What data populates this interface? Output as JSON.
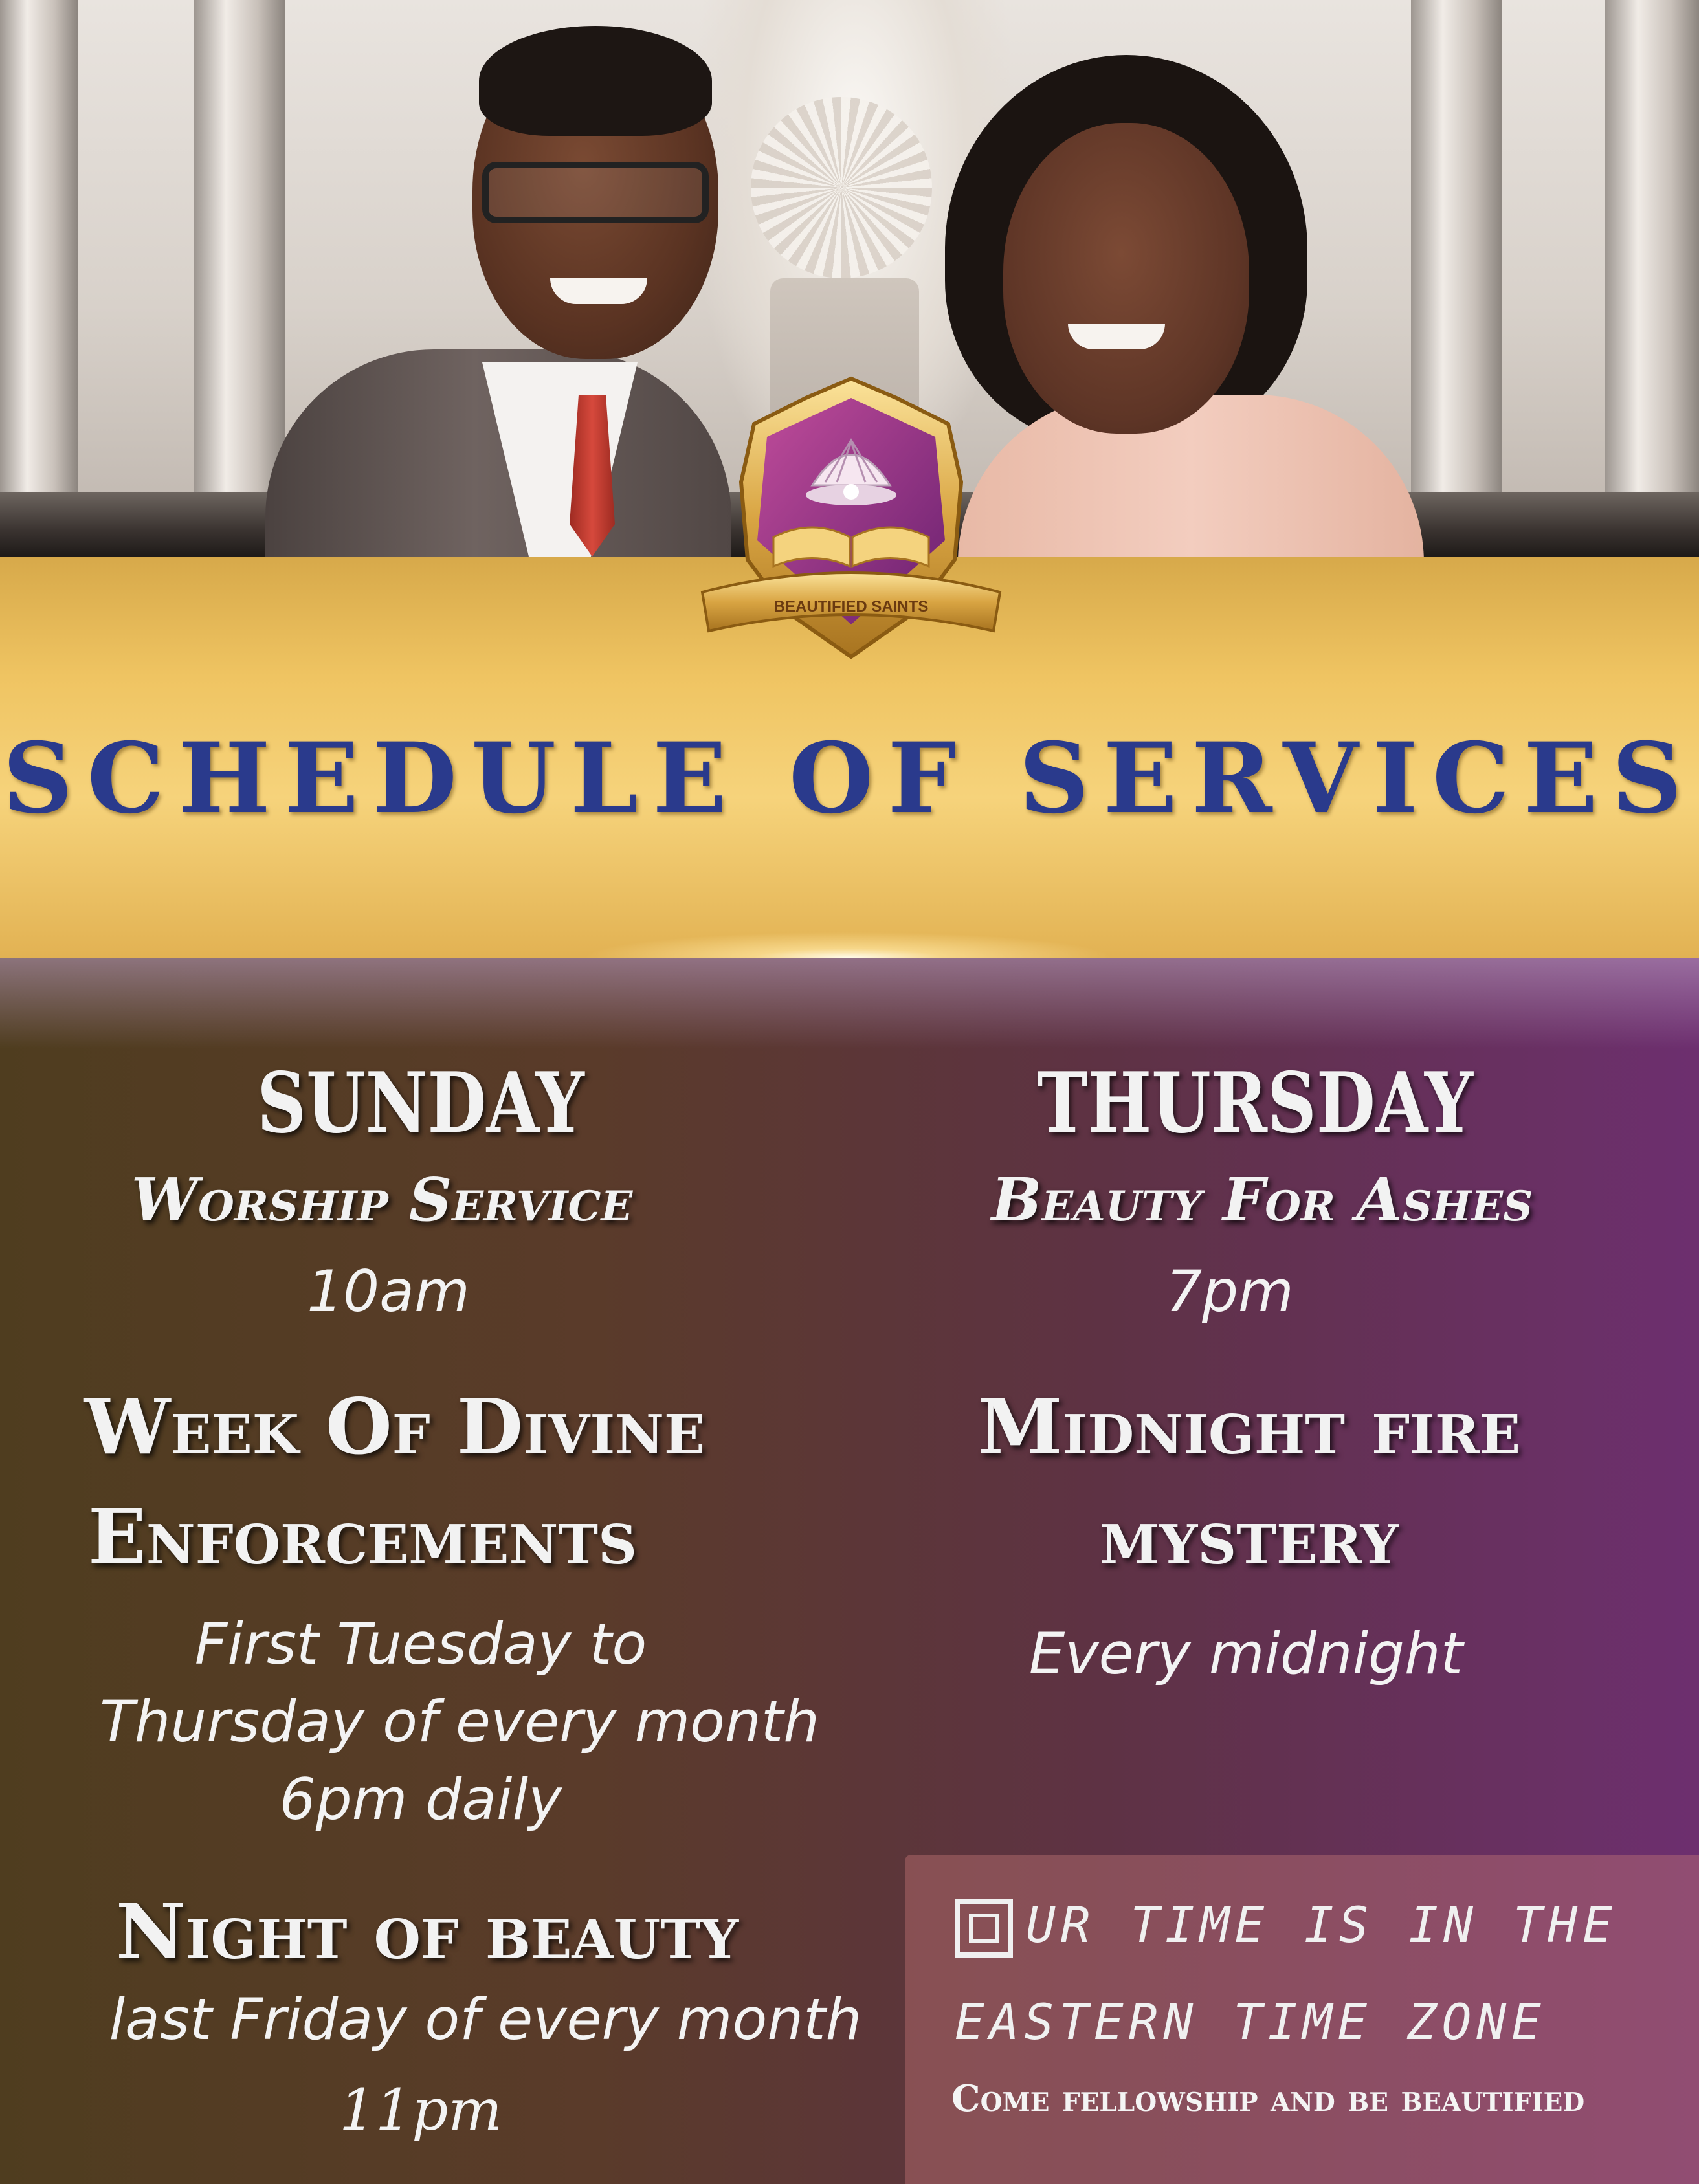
{
  "logo": {
    "banner_text": "BEAUTIFIED SAINTS"
  },
  "title": "SCHEDULE OF SERVICES",
  "left_column": {
    "sunday": {
      "day": "SUNDAY",
      "service": "Worship Service",
      "time": "10am"
    },
    "enforcements": {
      "title_line1": "Week Of Divine",
      "title_line2": "Enforcements",
      "detail_line1": "First Tuesday to",
      "detail_line2": "Thursday of every month",
      "detail_line3": "6pm daily"
    },
    "night": {
      "title": "Night of beauty",
      "detail": "last Friday of every month",
      "time": "11pm"
    }
  },
  "right_column": {
    "thursday": {
      "day": "THURSDAY",
      "service": "Beauty For Ashes",
      "time": "7pm"
    },
    "midnight": {
      "title_line1": "Midnight fire",
      "title_line2": "mystery",
      "detail": "Every midnight"
    }
  },
  "timezone_box": {
    "line1": "UR TIME IS IN THE",
    "line2": "EASTERN TIME ZONE",
    "footer": "Come fellowship and be beautified"
  },
  "colors": {
    "gold": "#efc462",
    "title_blue": "#2a3a8c",
    "purple": "#6d2f6f",
    "brown": "#4f3d1f"
  }
}
